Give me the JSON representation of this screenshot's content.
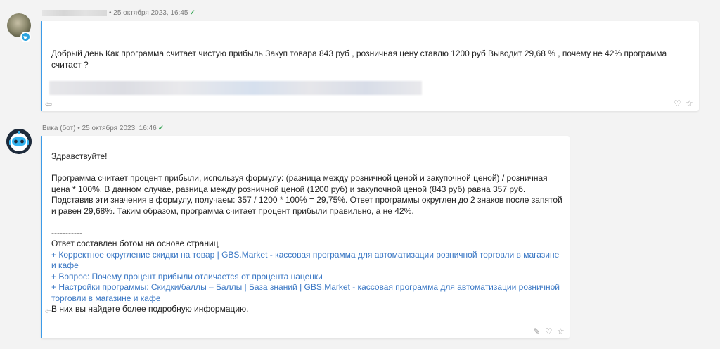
{
  "messages": [
    {
      "sender": "",
      "timestamp": "25 октября 2023, 16:45",
      "text": "Добрый день Как программа считает чистую прибыль Закуп товара 843 руб , розничная цену ставлю 1200 руб Выводит 29,68 % , почему не 42% программа считает ?"
    },
    {
      "sender": "Вика (бот)",
      "timestamp": "25 октября 2023, 16:46",
      "greeting": "Здравствуйте!",
      "paragraph": [
        "Программа считает процент прибыли, используя формулу: (разница между розничной ценой и закупочной ценой) / розничная",
        "цена * 100%. В данном случае, разница между розничной ценой (1200 руб) и закупочной ценой (843 руб) равна 357 руб.",
        "Подставив эти значения в формулу, получаем: 357 / 1200 * 100% = 29,75%. Ответ программы округлен до 2 знаков после запятой",
        "и равен 29,68%. Таким образом, программа считает процент прибыли правильно, а не 42%."
      ],
      "separator": "-----------",
      "sources_intro": "Ответ составлен ботом на основе страниц",
      "links": [
        [
          "+ Корректное округление скидки на товар | GBS.Market - кассовая программа для автоматизации розничной торговли в магазине",
          "и кафе"
        ],
        [
          "+ Вопрос: Почему процент прибыли отличается от процента наценки"
        ],
        [
          "+ Настройки программы: Скидки/баллы – Баллы | База знаний | GBS.Market - кассовая программа для автоматизации розничной",
          "торговли в магазине и кафе"
        ]
      ],
      "closing": "В них вы найдете более подробную информацию."
    }
  ],
  "icons": [
    "reply-icon",
    "like-icon",
    "star-icon",
    "pin-icon",
    "telegram-icon",
    "check-icon"
  ]
}
